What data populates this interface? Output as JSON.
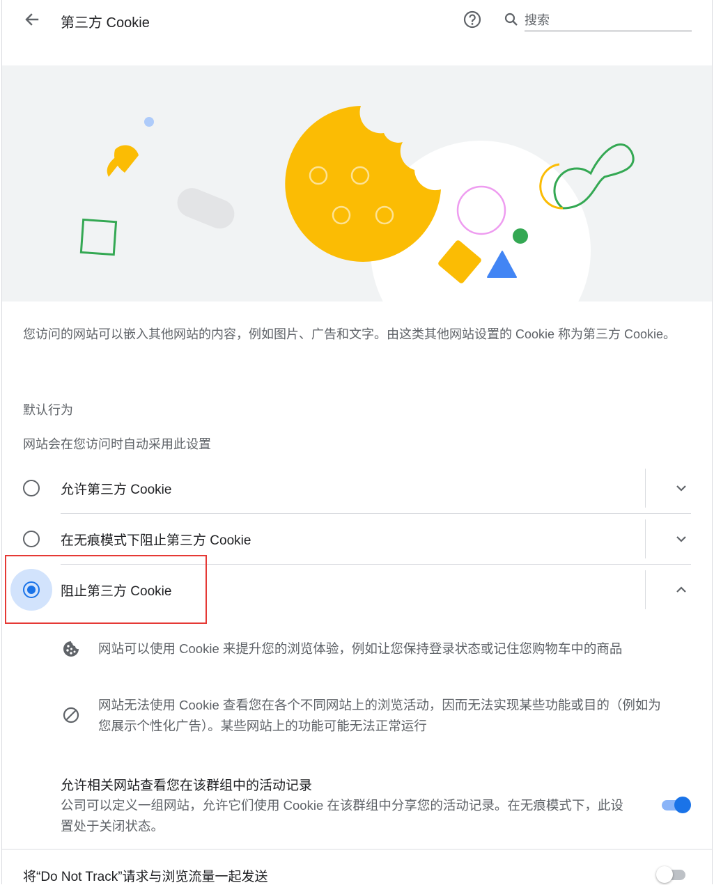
{
  "header": {
    "title": "第三方 Cookie",
    "search_placeholder": "搜索"
  },
  "description": "您访问的网站可以嵌入其他网站的内容，例如图片、广告和文字。由这类其他网站设置的 Cookie 称为第三方 Cookie。",
  "default_behavior": {
    "label": "默认行为",
    "sublabel": "网站会在您访问时自动采用此设置",
    "options": [
      {
        "label": "允许第三方 Cookie",
        "selected": false,
        "expanded": false
      },
      {
        "label": "在无痕模式下阻止第三方 Cookie",
        "selected": false,
        "expanded": false
      },
      {
        "label": "阻止第三方 Cookie",
        "selected": true,
        "expanded": true
      }
    ]
  },
  "details": [
    {
      "icon": "cookie-icon",
      "text": "网站可以使用 Cookie 来提升您的浏览体验，例如让您保持登录状态或记住您购物车中的商品"
    },
    {
      "icon": "block-icon",
      "text_line1": "网站无法使用 Cookie 查看您在各个不同网站上的浏览活动，因而无法实现某些功能或目的（例如为",
      "text_line2": "您展示个性化广告）。某些网站上的功能可能无法正常运行"
    }
  ],
  "related_sites": {
    "title": "允许相关网站查看您在该群组中的活动记录",
    "description": "公司可以定义一组网站，允许它们使用 Cookie 在该群组中分享您的活动记录。在无痕模式下，此设置处于关闭状态。",
    "enabled": true
  },
  "do_not_track": {
    "label": "将“Do Not Track”请求与浏览流量一起发送",
    "enabled": false
  },
  "colors": {
    "accent": "#1a73e8",
    "highlight": "#e53935",
    "cookie": "#fbbc04",
    "green": "#34a853",
    "blue": "#4285f4",
    "pink": "#ee9cf0"
  }
}
